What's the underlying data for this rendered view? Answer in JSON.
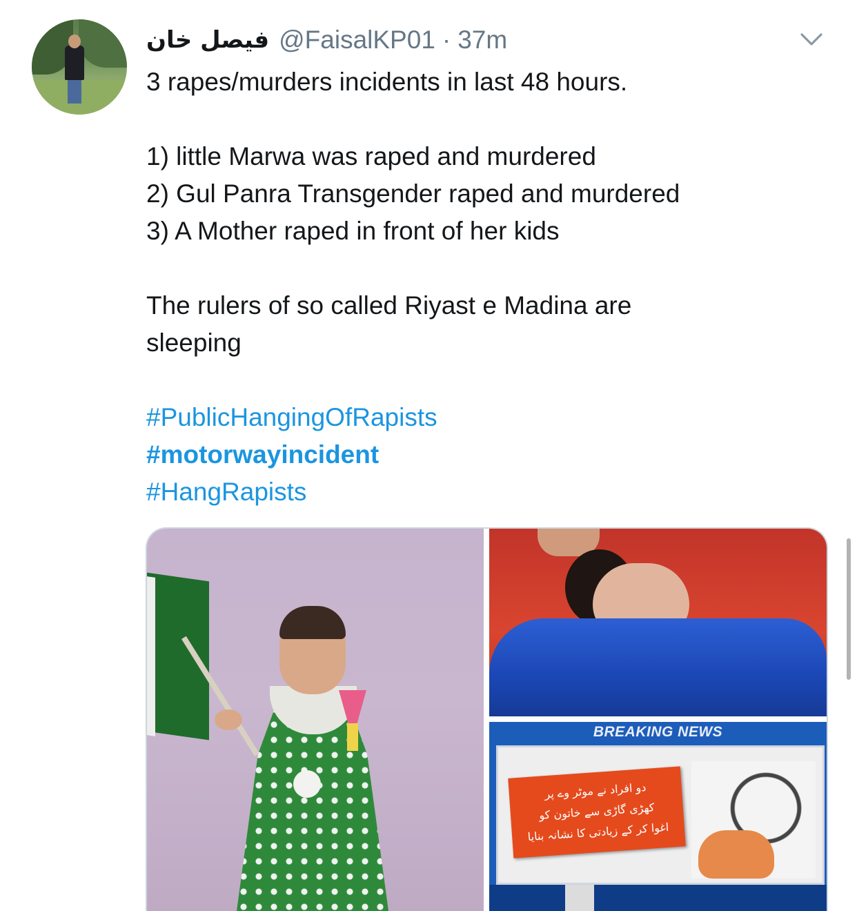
{
  "tweet": {
    "display_name": "فیصل خان",
    "handle": "@FaisalKP01",
    "separator": "·",
    "time": "37m",
    "lines": {
      "intro": "3 rapes/murders incidents in last 48 hours.",
      "item1": "1) little Marwa was raped and murdered",
      "item2": "2) Gul Panra Transgender raped and murdered",
      "item3": "3) A Mother raped in front of her kids",
      "statement_line1": "The rulers of so called Riyast e Madina are",
      "statement_line2": "sleeping"
    },
    "hashtags": [
      "#PublicHangingOfRapists",
      "#motorwayincident",
      "#HangRapists"
    ],
    "hashtag_color": "#1b95e0"
  },
  "media": {
    "breaking_label": "BREAKING NEWS",
    "urdu_lines": [
      "دو افراد نے موٹر وے پر",
      "کھڑی گاڑی سے خاتون کو",
      "اغوا کر کے زیادتی کا نشانہ بنایا"
    ]
  },
  "icons": {
    "caret": "chevron-down-icon"
  }
}
